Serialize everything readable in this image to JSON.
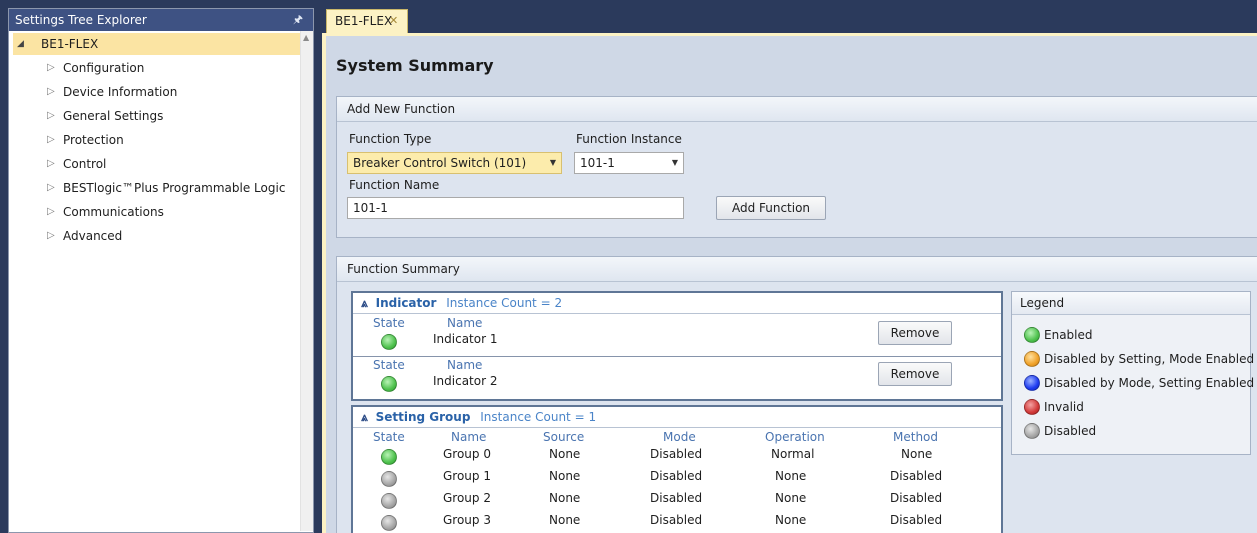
{
  "left_panel": {
    "title": "Settings Tree Explorer",
    "pin_glyph": "🖈",
    "root": {
      "arrow": "◢",
      "label": "BE1-FLEX"
    },
    "items": [
      {
        "arrow": "▷",
        "label": "Configuration"
      },
      {
        "arrow": "▷",
        "label": "Device Information"
      },
      {
        "arrow": "▷",
        "label": "General Settings"
      },
      {
        "arrow": "▷",
        "label": "Protection"
      },
      {
        "arrow": "▷",
        "label": "Control"
      },
      {
        "arrow": "▷",
        "label": "BESTlogic™Plus Programmable Logic"
      },
      {
        "arrow": "▷",
        "label": "Communications"
      },
      {
        "arrow": "▷",
        "label": "Advanced"
      }
    ]
  },
  "tab": {
    "label": "BE1-FLEX",
    "close": "✕"
  },
  "page": {
    "title": "System Summary"
  },
  "add_function": {
    "header": "Add New Function",
    "function_type_label": "Function Type",
    "function_type_value": "Breaker Control Switch (101)",
    "function_instance_label": "Function Instance",
    "function_instance_value": "101-1",
    "function_name_label": "Function Name",
    "function_name_value": "101-1",
    "add_button": "Add Function",
    "dropdown_glyph": "▼"
  },
  "function_summary": {
    "header": "Function Summary",
    "indicator": {
      "chevron": "⩓",
      "title": "Indicator",
      "count": "Instance Count = 2",
      "state_header": "State",
      "name_header": "Name",
      "rows": [
        {
          "name": "Indicator 1",
          "state": "enabled",
          "remove": "Remove"
        },
        {
          "name": "Indicator 2",
          "state": "enabled",
          "remove": "Remove"
        }
      ]
    },
    "setting_group": {
      "chevron": "⩓",
      "title": "Setting Group",
      "count": "Instance Count = 1",
      "headers": [
        "State",
        "Name",
        "Source",
        "Mode",
        "Operation",
        "Method"
      ],
      "rows": [
        {
          "state": "enabled",
          "name": "Group 0",
          "source": "None",
          "mode": "Disabled",
          "operation": "Normal",
          "method": "None"
        },
        {
          "state": "disabled",
          "name": "Group 1",
          "source": "None",
          "mode": "Disabled",
          "operation": "None",
          "method": "Disabled"
        },
        {
          "state": "disabled",
          "name": "Group 2",
          "source": "None",
          "mode": "Disabled",
          "operation": "None",
          "method": "Disabled"
        },
        {
          "state": "disabled",
          "name": "Group 3",
          "source": "None",
          "mode": "Disabled",
          "operation": "None",
          "method": "Disabled"
        }
      ]
    }
  },
  "legend": {
    "title": "Legend",
    "items": [
      {
        "label": "Enabled",
        "color": "#4fc24e"
      },
      {
        "label": "Disabled by Setting, Mode Enabled",
        "color": "#f0a22a"
      },
      {
        "label": "Disabled by Mode, Setting Enabled",
        "color": "#1f3cf0"
      },
      {
        "label": "Invalid",
        "color": "#d23a3a"
      },
      {
        "label": "Disabled",
        "color": "#a6a6a6"
      }
    ]
  }
}
